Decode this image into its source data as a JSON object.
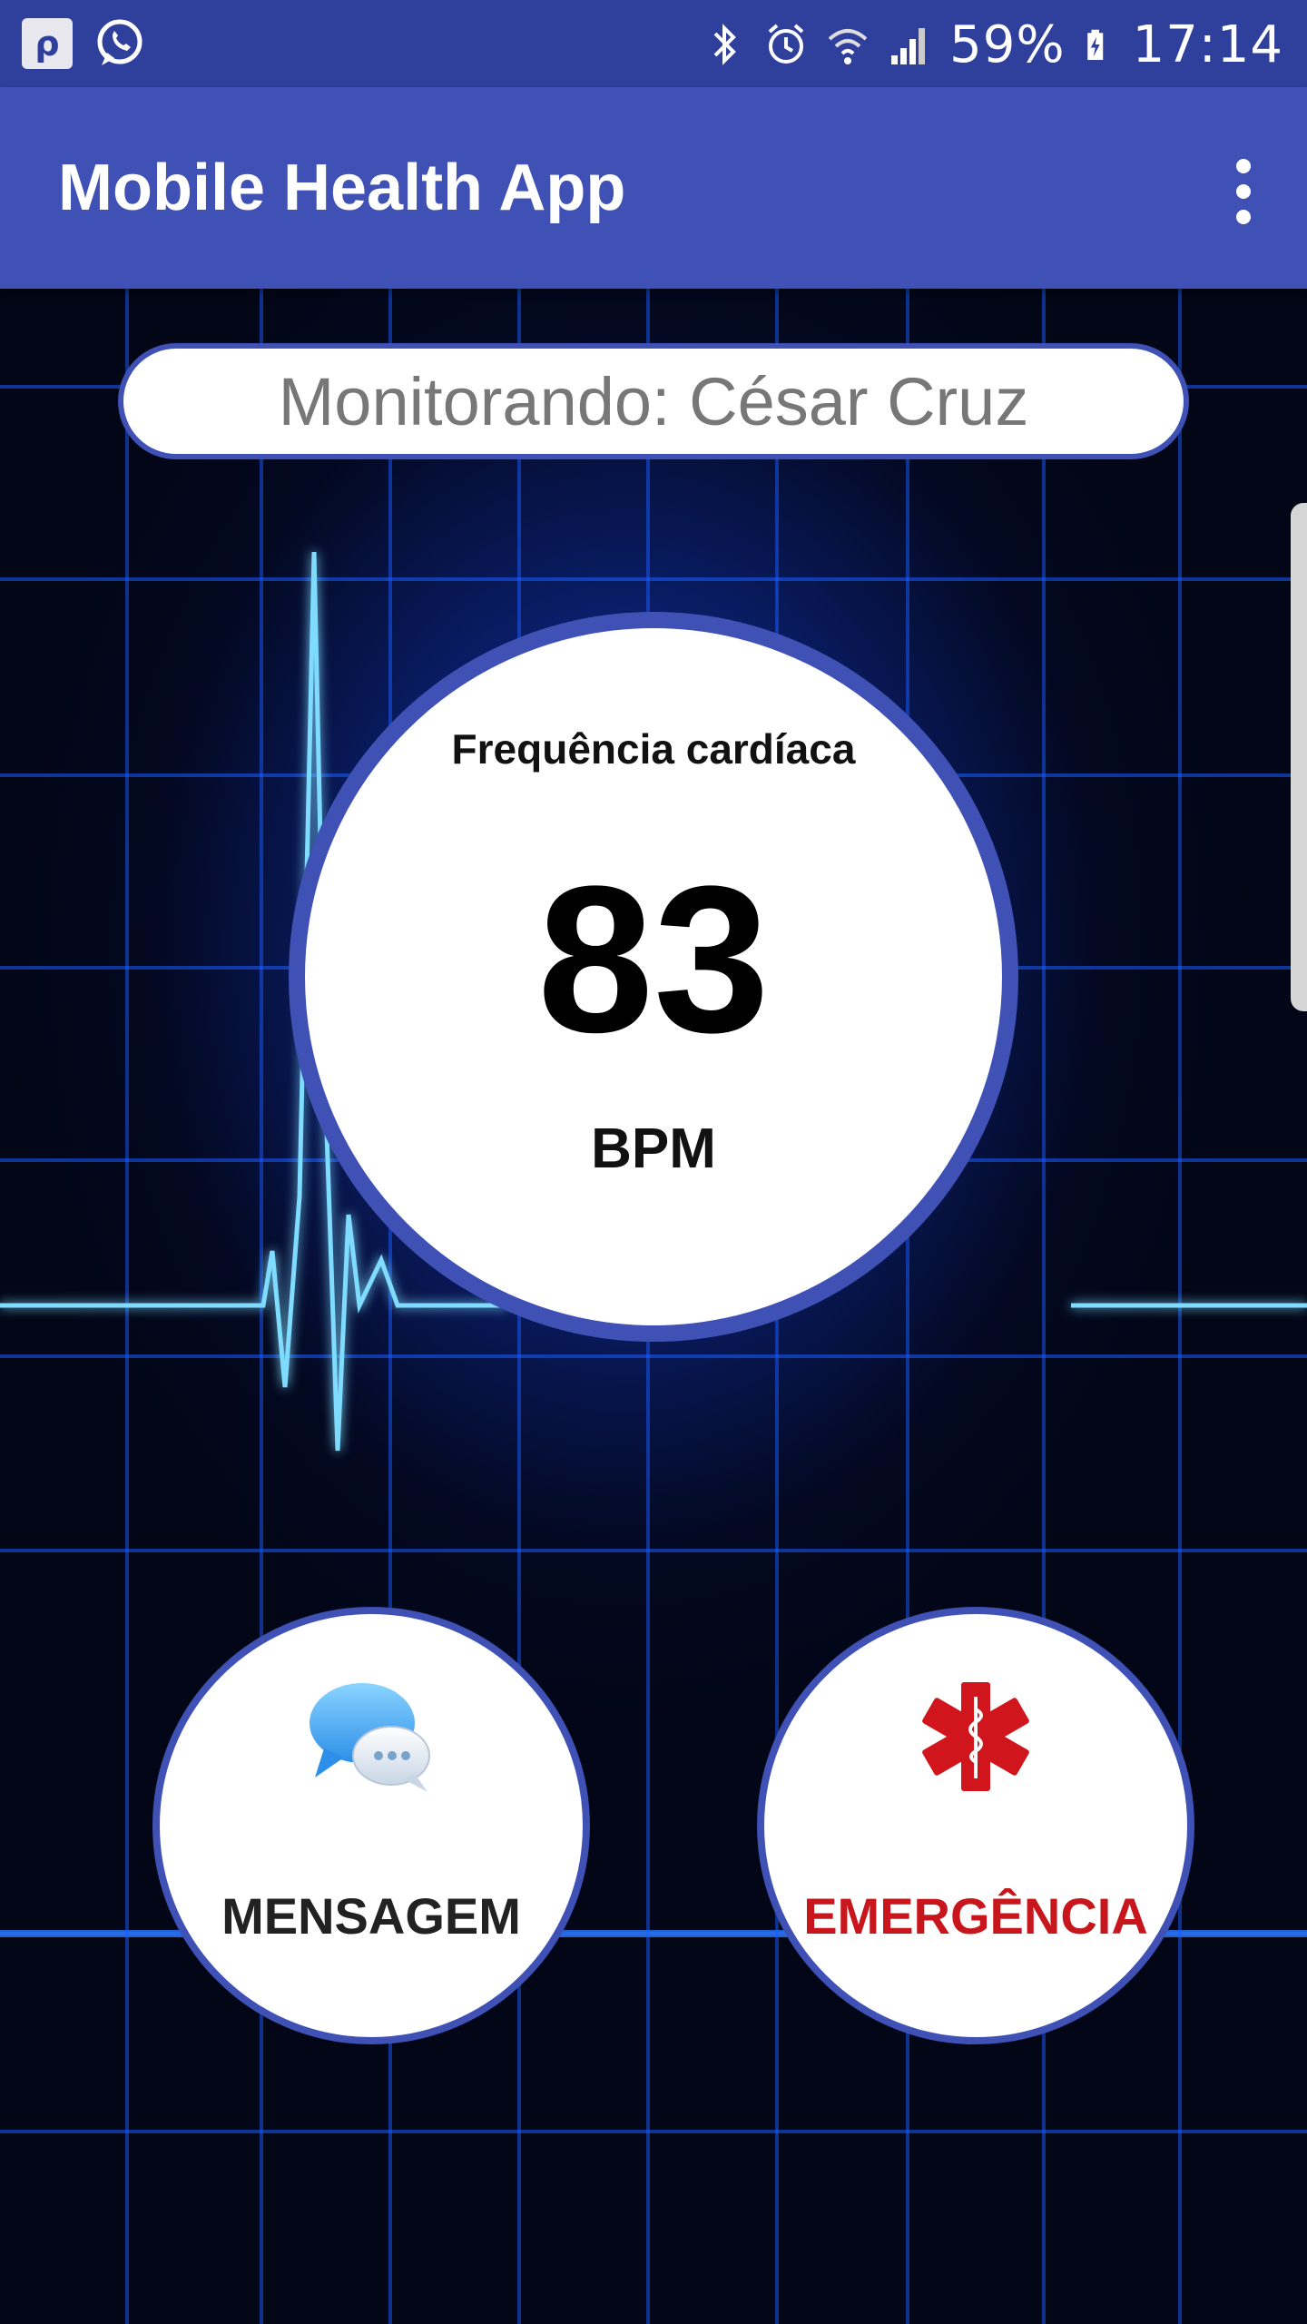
{
  "status_bar": {
    "battery": "59%",
    "time": "17:14",
    "icons": [
      "app-notification-icon",
      "whatsapp-icon",
      "bluetooth-icon",
      "alarm-icon",
      "wifi-icon",
      "signal-icon",
      "battery-charging-icon"
    ]
  },
  "app_bar": {
    "title": "Mobile Health App",
    "menu_icon": "overflow-menu-icon"
  },
  "patient": {
    "label": "Monitorando: César Cruz"
  },
  "heart_rate": {
    "label": "Frequência cardíaca",
    "value": "83",
    "unit": "BPM"
  },
  "actions": {
    "message": {
      "label": "MENSAGEM",
      "icon": "chat-bubbles-icon"
    },
    "emergency": {
      "label": "EMERGÊNCIA",
      "icon": "star-of-life-icon"
    }
  },
  "colors": {
    "primary": "#3f51b5",
    "primary_dark": "#2f3f9c",
    "emergency_red": "#c8161d",
    "ecg_cyan": "#3ec8ff"
  }
}
